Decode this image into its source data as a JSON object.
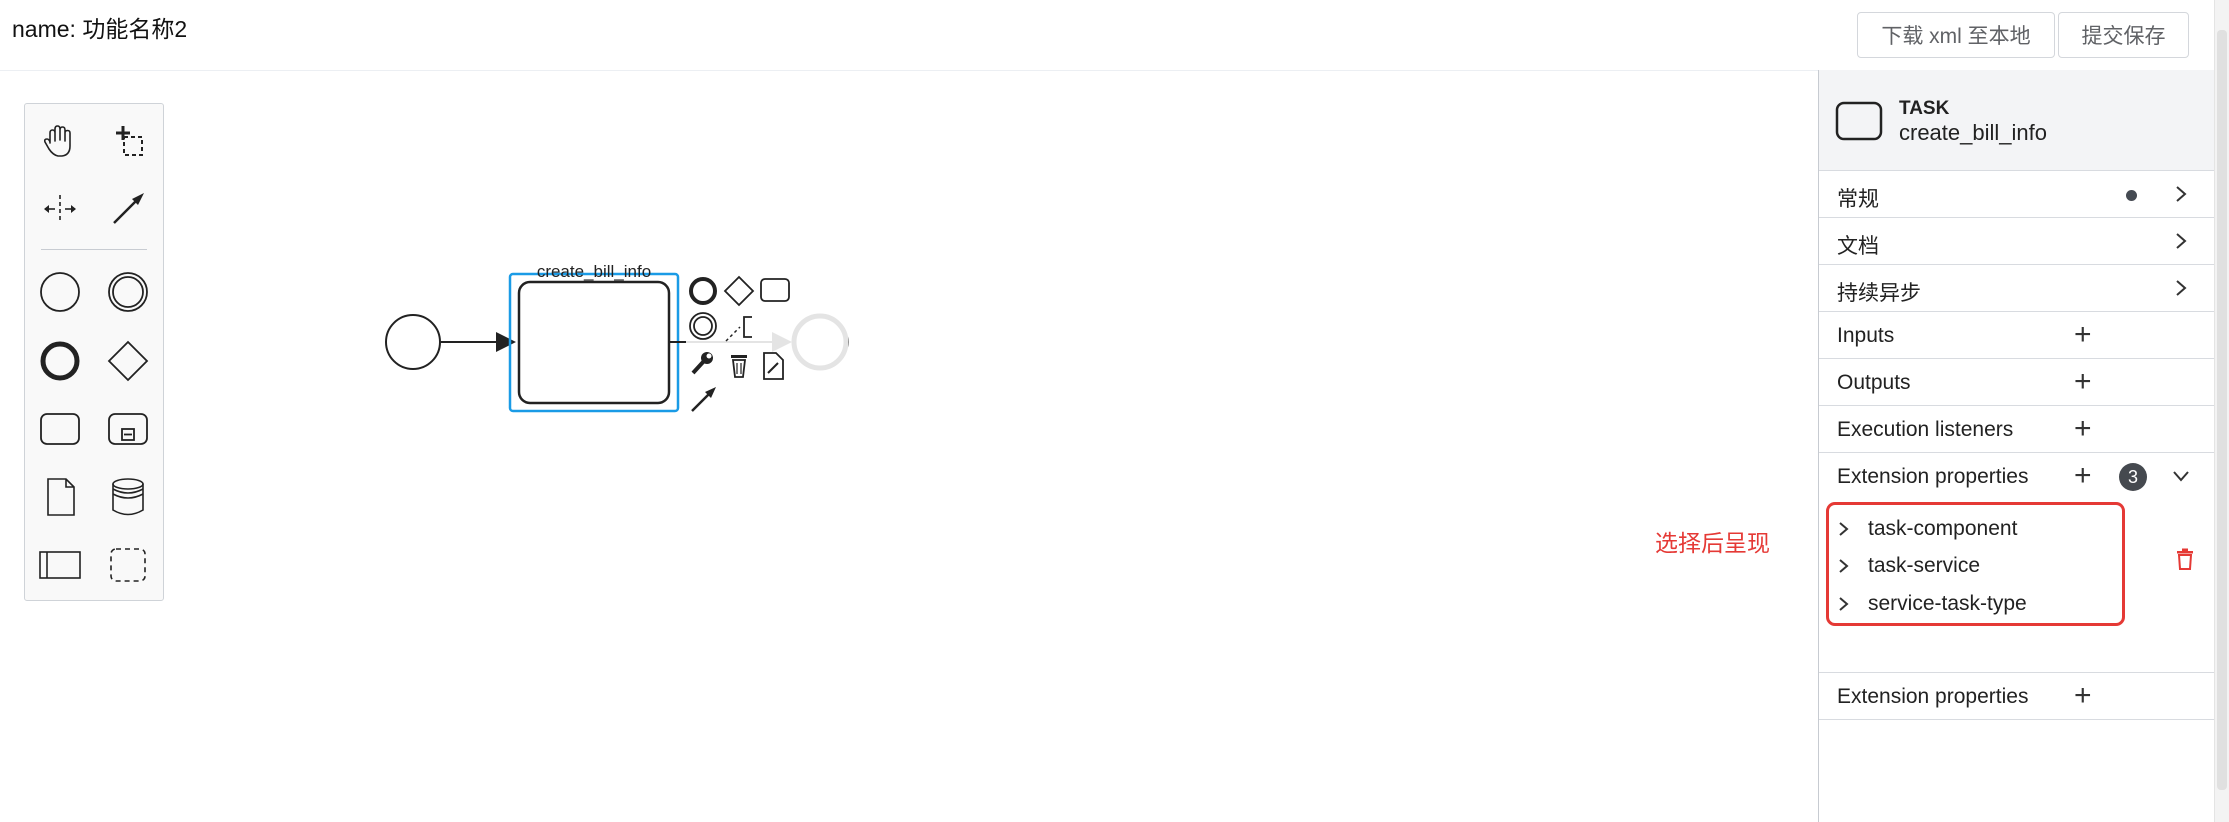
{
  "header": {
    "title": "name: 功能名称2",
    "download_button": "下载 xml 至本地",
    "save_button": "提交保存"
  },
  "palette": {
    "tools": [
      "hand-tool",
      "lasso-tool",
      "space-tool",
      "global-connect-tool",
      "start-event",
      "intermediate-event",
      "end-event",
      "gateway",
      "task",
      "subprocess",
      "data-object",
      "data-store",
      "pool",
      "group"
    ]
  },
  "diagram": {
    "task_label": "create_bill_info"
  },
  "annotation": "选择后呈现",
  "panel": {
    "element_type": "TASK",
    "element_name": "create_bill_info",
    "groups": {
      "general": "常规",
      "documentation": "文档",
      "async": "持续异步",
      "inputs": "Inputs",
      "outputs": "Outputs",
      "execution_listeners": "Execution listeners",
      "extension_properties": "Extension properties",
      "extension_properties_2": "Extension properties"
    },
    "extension_count": "3",
    "extension_items": [
      "task-component",
      "task-service",
      "service-task-type"
    ]
  },
  "colors": {
    "selection": "#1a9be6",
    "annotation": "#e53935",
    "badge": "#45494f"
  }
}
